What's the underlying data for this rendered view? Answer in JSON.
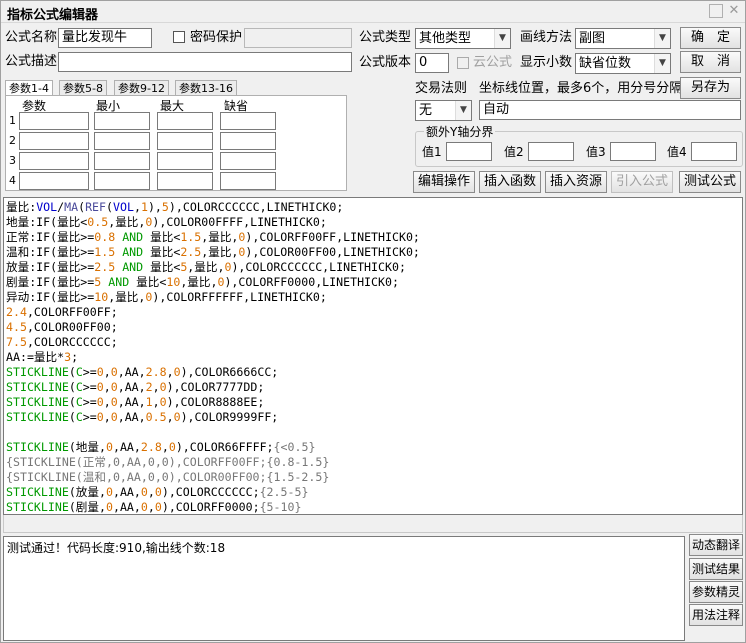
{
  "window": {
    "title": "指标公式编辑器"
  },
  "form": {
    "name_label": "公式名称",
    "name_value": "量比发现牛",
    "password_label": "密码保护",
    "desc_label": "公式描述",
    "desc_value": "",
    "type_label": "公式类型",
    "type_value": "其他类型",
    "draw_method_label": "画线方法",
    "draw_method_value": "副图",
    "version_label": "公式版本",
    "version_value": "0",
    "cloud_label": "云公式",
    "decimals_label": "显示小数",
    "decimals_value": "缺省位数",
    "trade_rule_label": "交易法则",
    "trade_rule_value": "无",
    "coord_label": "坐标线位置，最多6个，用分号分隔",
    "coord_value": "自动",
    "extra_y_label": "额外Y轴分界",
    "y_values": [
      "值1",
      "值2",
      "值3",
      "值4"
    ]
  },
  "buttons": {
    "ok": "确　定",
    "cancel": "取　消",
    "save_as": "另存为",
    "edit_ops": "编辑操作",
    "insert_fn": "插入函数",
    "insert_res": "插入资源",
    "import_formula": "引入公式",
    "test_formula": "测试公式"
  },
  "params": {
    "tabs": [
      "参数1-4",
      "参数5-8",
      "参数9-12",
      "参数13-16"
    ],
    "headers": [
      "参数",
      "最小",
      "最大",
      "缺省"
    ],
    "rows": [
      "1",
      "2",
      "3",
      "4"
    ]
  },
  "code": [
    [
      [
        "c-str",
        "量比"
      ],
      [
        "c-str",
        ":"
      ],
      [
        "c-sys",
        "VOL"
      ],
      [
        "c-str",
        "/"
      ],
      [
        "c-fn",
        "MA"
      ],
      [
        "c-str",
        "("
      ],
      [
        "c-fn",
        "REF"
      ],
      [
        "c-str",
        "("
      ],
      [
        "c-sys",
        "VOL"
      ],
      [
        "c-str",
        ","
      ],
      [
        "c-num",
        "1"
      ],
      [
        "c-str",
        "),"
      ],
      [
        "c-num",
        "5"
      ],
      [
        "c-str",
        "),COLORCCCCCC,LINETHICK0;"
      ]
    ],
    [
      [
        "c-str",
        "地量:IF(量比<"
      ],
      [
        "c-num",
        "0.5"
      ],
      [
        "c-str",
        ",量比,"
      ],
      [
        "c-num",
        "0"
      ],
      [
        "c-str",
        "),COLOR00FFFF,LINETHICK0;"
      ]
    ],
    [
      [
        "c-str",
        "正常:IF(量比>="
      ],
      [
        "c-num",
        "0.8"
      ],
      [
        "c-str",
        " "
      ],
      [
        "c-kw",
        "AND"
      ],
      [
        "c-str",
        " 量比<"
      ],
      [
        "c-num",
        "1.5"
      ],
      [
        "c-str",
        ",量比,"
      ],
      [
        "c-num",
        "0"
      ],
      [
        "c-str",
        "),COLORFF00FF,LINETHICK0;"
      ]
    ],
    [
      [
        "c-str",
        "温和:IF(量比>="
      ],
      [
        "c-num",
        "1.5"
      ],
      [
        "c-str",
        " "
      ],
      [
        "c-kw",
        "AND"
      ],
      [
        "c-str",
        " 量比<"
      ],
      [
        "c-num",
        "2.5"
      ],
      [
        "c-str",
        ",量比,"
      ],
      [
        "c-num",
        "0"
      ],
      [
        "c-str",
        "),COLOR00FF00,LINETHICK0;"
      ]
    ],
    [
      [
        "c-str",
        "放量:IF(量比>="
      ],
      [
        "c-num",
        "2.5"
      ],
      [
        "c-str",
        " "
      ],
      [
        "c-kw",
        "AND"
      ],
      [
        "c-str",
        " 量比<"
      ],
      [
        "c-num",
        "5"
      ],
      [
        "c-str",
        ",量比,"
      ],
      [
        "c-num",
        "0"
      ],
      [
        "c-str",
        "),COLORCCCCCC,LINETHICK0;"
      ]
    ],
    [
      [
        "c-str",
        "剧量:IF(量比>="
      ],
      [
        "c-num",
        "5"
      ],
      [
        "c-str",
        " "
      ],
      [
        "c-kw",
        "AND"
      ],
      [
        "c-str",
        " 量比<"
      ],
      [
        "c-num",
        "10"
      ],
      [
        "c-str",
        ",量比,"
      ],
      [
        "c-num",
        "0"
      ],
      [
        "c-str",
        "),COLORFF0000,LINETHICK0;"
      ]
    ],
    [
      [
        "c-str",
        "异动:IF(量比>="
      ],
      [
        "c-num",
        "10"
      ],
      [
        "c-str",
        ",量比,"
      ],
      [
        "c-num",
        "0"
      ],
      [
        "c-str",
        "),COLORFFFFFF,LINETHICK0;"
      ]
    ],
    [
      [
        "c-num",
        "2.4"
      ],
      [
        "c-str",
        ",COLORFF00FF;"
      ]
    ],
    [
      [
        "c-num",
        "4.5"
      ],
      [
        "c-str",
        ",COLOR00FF00;"
      ]
    ],
    [
      [
        "c-num",
        "7.5"
      ],
      [
        "c-str",
        ",COLORCCCCCC;"
      ]
    ],
    [
      [
        "c-str",
        "AA:=量比*"
      ],
      [
        "c-num",
        "3"
      ],
      [
        "c-str",
        ";"
      ]
    ],
    [
      [
        "c-kw",
        "STICKLINE"
      ],
      [
        "c-str",
        "("
      ],
      [
        "c-kw",
        "C"
      ],
      [
        "c-str",
        ">="
      ],
      [
        "c-num",
        "0"
      ],
      [
        "c-str",
        ","
      ],
      [
        "c-num",
        "0"
      ],
      [
        "c-str",
        ",AA,"
      ],
      [
        "c-num",
        "2.8"
      ],
      [
        "c-str",
        ","
      ],
      [
        "c-num",
        "0"
      ],
      [
        "c-str",
        "),COLOR6666CC;"
      ]
    ],
    [
      [
        "c-kw",
        "STICKLINE"
      ],
      [
        "c-str",
        "("
      ],
      [
        "c-kw",
        "C"
      ],
      [
        "c-str",
        ">="
      ],
      [
        "c-num",
        "0"
      ],
      [
        "c-str",
        ","
      ],
      [
        "c-num",
        "0"
      ],
      [
        "c-str",
        ",AA,"
      ],
      [
        "c-num",
        "2"
      ],
      [
        "c-str",
        ","
      ],
      [
        "c-num",
        "0"
      ],
      [
        "c-str",
        "),COLOR7777DD;"
      ]
    ],
    [
      [
        "c-kw",
        "STICKLINE"
      ],
      [
        "c-str",
        "("
      ],
      [
        "c-kw",
        "C"
      ],
      [
        "c-str",
        ">="
      ],
      [
        "c-num",
        "0"
      ],
      [
        "c-str",
        ","
      ],
      [
        "c-num",
        "0"
      ],
      [
        "c-str",
        ",AA,"
      ],
      [
        "c-num",
        "1"
      ],
      [
        "c-str",
        ","
      ],
      [
        "c-num",
        "0"
      ],
      [
        "c-str",
        "),COLOR8888EE;"
      ]
    ],
    [
      [
        "c-kw",
        "STICKLINE"
      ],
      [
        "c-str",
        "("
      ],
      [
        "c-kw",
        "C"
      ],
      [
        "c-str",
        ">="
      ],
      [
        "c-num",
        "0"
      ],
      [
        "c-str",
        ","
      ],
      [
        "c-num",
        "0"
      ],
      [
        "c-str",
        ",AA,"
      ],
      [
        "c-num",
        "0.5"
      ],
      [
        "c-str",
        ","
      ],
      [
        "c-num",
        "0"
      ],
      [
        "c-str",
        "),COLOR9999FF;"
      ]
    ],
    [],
    [
      [
        "c-kw",
        "STICKLINE"
      ],
      [
        "c-str",
        "(地量,"
      ],
      [
        "c-num",
        "0"
      ],
      [
        "c-str",
        ",AA,"
      ],
      [
        "c-num",
        "2.8"
      ],
      [
        "c-str",
        ","
      ],
      [
        "c-num",
        "0"
      ],
      [
        "c-str",
        "),COLOR66FFFF;"
      ],
      [
        "c-cmt",
        "{<0.5}"
      ]
    ],
    [
      [
        "c-cmt",
        "{STICKLINE(正常,0,AA,0,0),COLORFF00FF;{0.8-1.5}"
      ]
    ],
    [
      [
        "c-cmt",
        "{STICKLINE(温和,0,AA,0,0),COLOR00FF00;{1.5-2.5}"
      ]
    ],
    [
      [
        "c-kw",
        "STICKLINE"
      ],
      [
        "c-str",
        "(放量,"
      ],
      [
        "c-num",
        "0"
      ],
      [
        "c-str",
        ",AA,"
      ],
      [
        "c-num",
        "0"
      ],
      [
        "c-str",
        ","
      ],
      [
        "c-num",
        "0"
      ],
      [
        "c-str",
        "),COLORCCCCCC;"
      ],
      [
        "c-cmt",
        "{2.5-5}"
      ]
    ],
    [
      [
        "c-kw",
        "STICKLINE"
      ],
      [
        "c-str",
        "(剧量,"
      ],
      [
        "c-num",
        "0"
      ],
      [
        "c-str",
        ",AA,"
      ],
      [
        "c-num",
        "0"
      ],
      [
        "c-str",
        ","
      ],
      [
        "c-num",
        "0"
      ],
      [
        "c-str",
        "),COLORFF0000;"
      ],
      [
        "c-cmt",
        "{5-10}"
      ]
    ]
  ],
  "output": {
    "message": "测试通过！代码长度:910,输出线个数:18"
  },
  "side_buttons": {
    "dynamic_translate": "动态翻译",
    "test_result": "测试结果",
    "param_wizard": "参数精灵",
    "usage_notes": "用法注释"
  }
}
